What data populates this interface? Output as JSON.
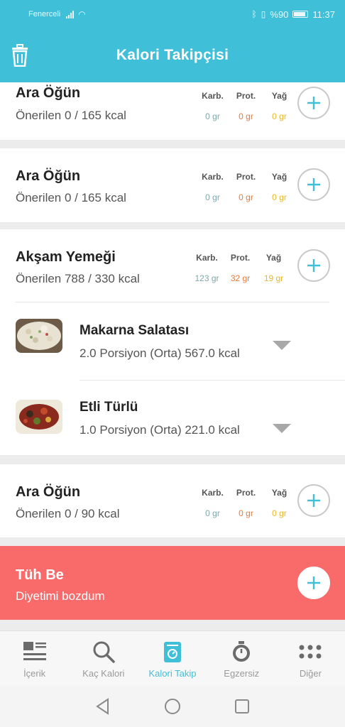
{
  "status": {
    "carrier": "Fenerceli",
    "battery": "%90",
    "time": "11:37"
  },
  "appbar": {
    "title": "Kalori Takipçisi"
  },
  "macro_labels": {
    "carb": "Karb.",
    "prot": "Prot.",
    "fat": "Yağ"
  },
  "meals": [
    {
      "name": "Ara Öğün",
      "subtitle": "Önerilen 0 / 165 kcal",
      "carb": "0 gr",
      "prot": "0 gr",
      "fat": "0 gr"
    },
    {
      "name": "Ara Öğün",
      "subtitle": "Önerilen 0 / 165 kcal",
      "carb": "0 gr",
      "prot": "0 gr",
      "fat": "0 gr"
    },
    {
      "name": "Akşam Yemeği",
      "subtitle": "Önerilen 788 / 330 kcal",
      "carb": "123 gr",
      "prot": "32 gr",
      "fat": "19 gr"
    },
    {
      "name": "Ara Öğün",
      "subtitle": "Önerilen 0 / 90 kcal",
      "carb": "0 gr",
      "prot": "0 gr",
      "fat": "0 gr"
    }
  ],
  "foods": [
    {
      "name": "Makarna Salatası",
      "detail": "2.0 Porsiyon (Orta) 567.0 kcal"
    },
    {
      "name": "Etli Türlü",
      "detail": "1.0 Porsiyon (Orta) 221.0 kcal"
    }
  ],
  "cheat": {
    "title": "Tüh Be",
    "subtitle": "Diyetimi bozdum"
  },
  "nav": [
    {
      "label": "İçerik",
      "icon": "article-icon"
    },
    {
      "label": "Kaç Kalori",
      "icon": "search-icon"
    },
    {
      "label": "Kalori Takip",
      "icon": "scale-icon",
      "active": true
    },
    {
      "label": "Egzersiz",
      "icon": "stopwatch-icon"
    },
    {
      "label": "Diğer",
      "icon": "dots-grid-icon"
    }
  ],
  "colors": {
    "primary": "#3fbfd8",
    "cheat": "#f96a6a",
    "carb": "#7fa7aa",
    "prot": "#e57a3a",
    "fat": "#e8b829"
  }
}
